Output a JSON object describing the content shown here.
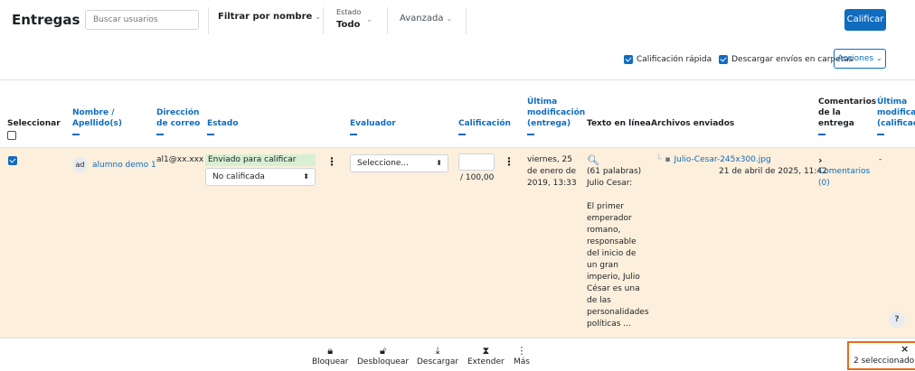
{
  "toolbar": {
    "title": "Entregas",
    "search_placeholder": "Buscar usuarios",
    "filter_label": "Filtrar por nombre",
    "estado_label": "Estado",
    "estado_value": "Todo",
    "avanzada_label": "Avanzada",
    "calificar_label": "Calificar"
  },
  "options": {
    "quick_grading_label": "Calificación rápida",
    "quick_grading_checked": true,
    "download_folders_label": "Descargar envíos en carpetas",
    "download_folders_checked": true,
    "acciones_label": "Acciones"
  },
  "headers": {
    "select": "Seleccionar",
    "name": "Nombre / Apellido(s)",
    "email": "Dirección de correo",
    "status": "Estado",
    "grader": "Evaluador",
    "grade": "Calificación",
    "last_mod_submission": "Última modificación (entrega)",
    "online_text": "Texto en línea",
    "files": "Archivos enviados",
    "feedback_comments": "Comentarios de la entrega",
    "last_mod_grade": "Última modificación (calificación)"
  },
  "row": {
    "checked": true,
    "avatar_initials": "ad",
    "name": "alumno demo 1",
    "email": "al1@xx.xxx",
    "status": "Enviado para calificar",
    "grading_status": "No calificada",
    "grader_select": "Seleccione...",
    "grade_value": "",
    "grade_max": "/ 100,00",
    "last_modified": "viernes, 25 de enero de 2019, 13:33",
    "word_count": "(61 palabras)",
    "online_text_lines": [
      "Julio Cesar:",
      "",
      "El primer",
      "emperador",
      "romano,",
      "responsable",
      "del inicio de",
      "un gran",
      "imperio, Julio",
      "César es una",
      "de las",
      "personalidades",
      "políticas ..."
    ],
    "file_name": "Julio-Cesar-245x300.jpg",
    "file_date": "21 de abril de 2025, 11:42",
    "comments_link": "Comentarios (0)",
    "last_mod_grade": "-"
  },
  "help_label": "?",
  "bottom_bar": {
    "items": [
      {
        "label": "Bloquear",
        "icon": "lock-icon"
      },
      {
        "label": "Desbloquear",
        "icon": "unlock-icon"
      },
      {
        "label": "Descargar",
        "icon": "download-icon"
      },
      {
        "label": "Extender",
        "icon": "hourglass-icon"
      },
      {
        "label": "Más",
        "icon": "kebab-icon"
      }
    ],
    "selected_text": "2 seleccionado",
    "close_label": "×"
  },
  "colors": {
    "accent": "#0f6cbf",
    "row_highlight": "#fcefdc",
    "submitted_badge": "#d7f0d3",
    "selection_border": "#e86a1a"
  }
}
